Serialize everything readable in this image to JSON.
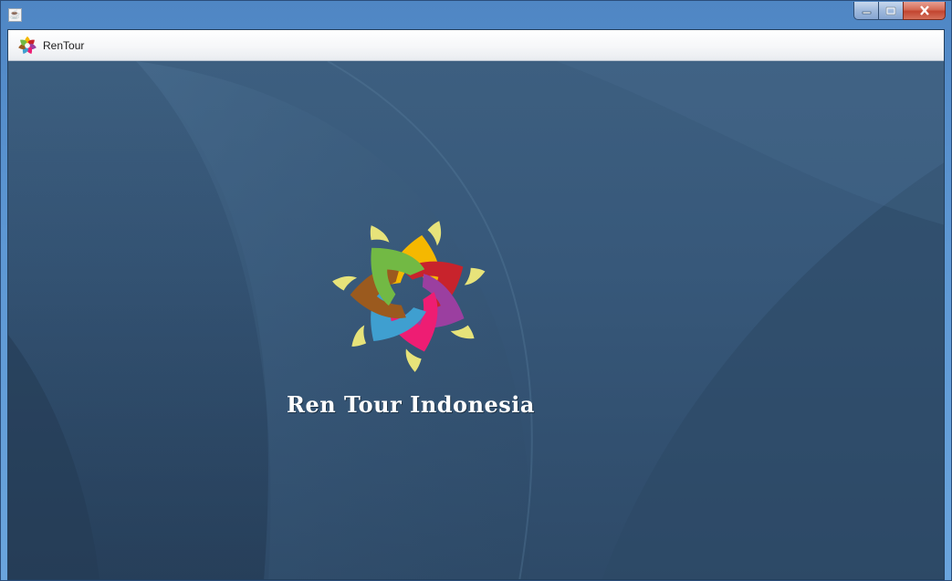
{
  "window": {
    "controls": {
      "minimize_icon": "minimize-icon",
      "maximize_icon": "maximize-icon",
      "close_icon": "close-icon"
    },
    "app_icon": "java-cup-icon"
  },
  "toolbar": {
    "menu_label": "RenTour",
    "menu_icon": "flower-logo-icon"
  },
  "content": {
    "brand_text": "Ren Tour Indonesia",
    "logo_icon": "flower-logo-icon",
    "petal_colors": [
      "#f5b800",
      "#c8232c",
      "#9b3fa0",
      "#ee1d73",
      "#3f9fd0",
      "#9b5a1e",
      "#72b944"
    ],
    "accent_leaf_color": "#e7e37a",
    "background_color": "#34536f"
  }
}
